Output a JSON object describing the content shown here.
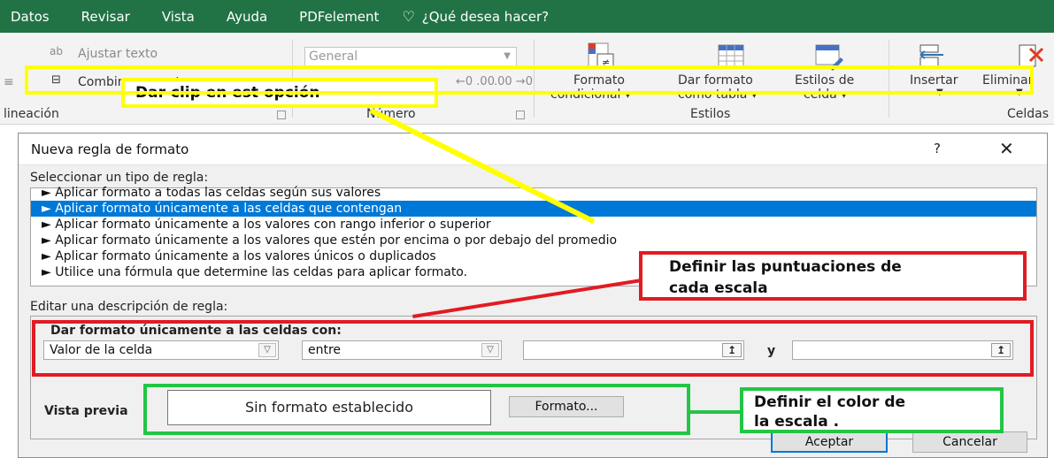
{
  "ribbon_tabs": [
    "Datos",
    "Revisar",
    "Vista",
    "Ayuda",
    "PDFelement"
  ],
  "search_prompt": "¿Qué desea hacer?",
  "ribbon": {
    "wrap_text": "Ajustar texto",
    "merge_center": "Combinar y centrar",
    "alignment_group": "lineación",
    "number_format": "General",
    "number_group": "Número",
    "conditional_format": [
      "Formato",
      "condicional"
    ],
    "format_as_table": [
      "Dar formato",
      "como tabla"
    ],
    "cell_styles": [
      "Estilos de",
      "celda"
    ],
    "styles_group": "Estilos",
    "insert": "Insertar",
    "delete": "Eliminar",
    "cells_group": "Celdas"
  },
  "annotations": {
    "click_option": "Dar clip en est opción",
    "define_scores": [
      "Definir las puntuaciones de",
      "cada escala"
    ],
    "define_color": [
      "Definir el color de",
      "la escala ."
    ],
    "colors": {
      "yellow": "#ffff00",
      "red": "#e11b22",
      "green": "#22c544"
    }
  },
  "dialog": {
    "title": "Nueva regla de formato",
    "help": "?",
    "close": "✕",
    "select_label": "Seleccionar un tipo de regla:",
    "rule_types": [
      "► Aplicar formato a todas las celdas según sus valores",
      "► Aplicar formato únicamente a las celdas que contengan",
      "► Aplicar formato únicamente a los valores con rango inferior o superior",
      "► Aplicar formato únicamente a los valores que estén por encima o por debajo del promedio",
      "► Aplicar formato únicamente a los valores únicos o duplicados",
      "► Utilice una fórmula que determine las celdas para aplicar formato."
    ],
    "selected_rule_index": 1,
    "edit_label": "Editar una descripción de regla:",
    "format_only_label": "Dar formato únicamente a las celdas con:",
    "cell_value_select": "Valor de la celda",
    "operator_select": "entre",
    "and_label": "y",
    "preview_label": "Vista previa",
    "preview_text": "Sin formato establecido",
    "format_button": "Formato...",
    "ok_button": "Aceptar",
    "cancel_button": "Cancelar",
    "selection_color": "#0078d7"
  }
}
